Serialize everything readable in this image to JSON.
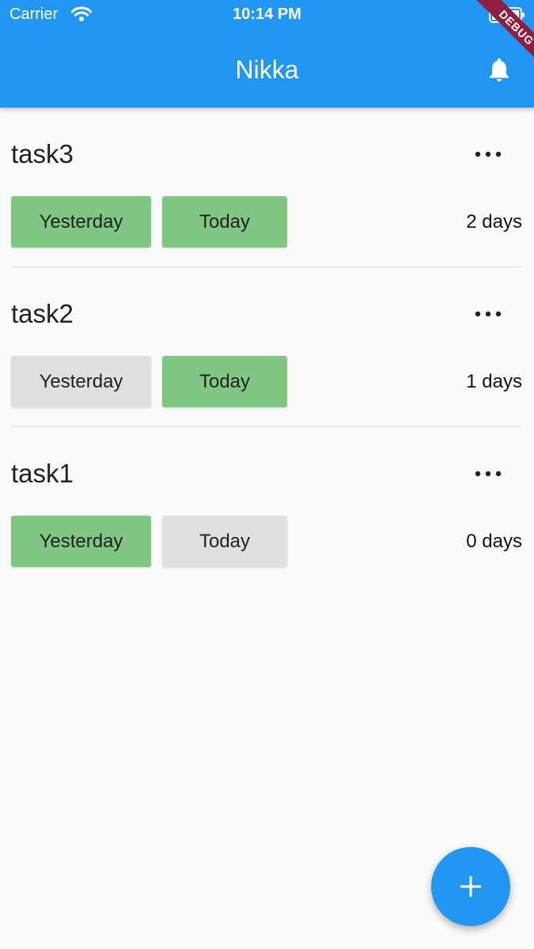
{
  "status_bar": {
    "carrier": "Carrier",
    "time": "10:14 PM"
  },
  "app_bar": {
    "title": "Nikka",
    "action_icon": "bell-icon",
    "color": "#2196F3"
  },
  "debug_banner": "DEBUG",
  "tasks": [
    {
      "name": "task3",
      "yesterday_label": "Yesterday",
      "yesterday_done": true,
      "today_label": "Today",
      "today_done": true,
      "streak": "2 days"
    },
    {
      "name": "task2",
      "yesterday_label": "Yesterday",
      "yesterday_done": false,
      "today_label": "Today",
      "today_done": true,
      "streak": "1 days"
    },
    {
      "name": "task1",
      "yesterday_label": "Yesterday",
      "yesterday_done": true,
      "today_label": "Today",
      "today_done": false,
      "streak": "0 days"
    }
  ],
  "colors": {
    "primary": "#2196F3",
    "done": "#81C784",
    "not_done": "#E0E0E0",
    "background": "#FAFAFA"
  },
  "fab": {
    "icon": "plus-icon"
  }
}
